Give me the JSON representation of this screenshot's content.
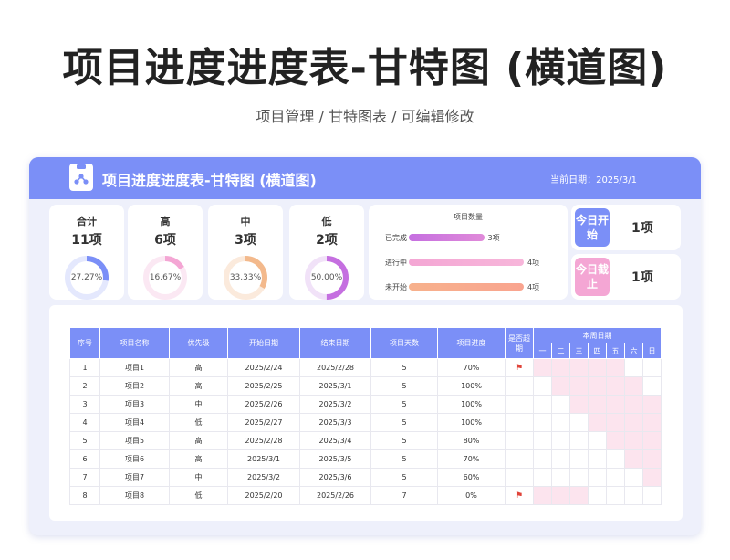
{
  "page": {
    "title": "项目进度进度表-甘特图 (横道图)",
    "subtitle": "项目管理 / 甘特图表 /  可编辑修改"
  },
  "header": {
    "title": "项目进度进度表-甘特图 (横道图)",
    "date_label": "当前日期：",
    "date_value": "2025/3/1"
  },
  "stats": [
    {
      "label": "合计",
      "count": "11项",
      "pct": "27.27%",
      "value": 0.2727,
      "color": "#7b8ff7",
      "track": "#e4e8fd"
    },
    {
      "label": "高",
      "count": "6项",
      "pct": "16.67%",
      "value": 0.1667,
      "color": "#f4a6d4",
      "track": "#fbe8f3"
    },
    {
      "label": "中",
      "count": "3项",
      "pct": "33.33%",
      "value": 0.3333,
      "color": "#f3b98c",
      "track": "#fbeadc"
    },
    {
      "label": "低",
      "count": "2项",
      "pct": "50.00%",
      "value": 0.5,
      "color": "#c56fe0",
      "track": "#f1e2f8"
    }
  ],
  "bar_chart": {
    "title": "项目数量",
    "rows": [
      {
        "label": "已完成",
        "value": 3,
        "value_label": "3项",
        "color_from": "#c56fe0",
        "color_to": "#e08ad9"
      },
      {
        "label": "进行中",
        "value": 4,
        "value_label": "4项",
        "color_from": "#f4a6d4",
        "color_to": "#f7b6da"
      },
      {
        "label": "未开始",
        "value": 4,
        "value_label": "4项",
        "color_from": "#f7b18c",
        "color_to": "#f9a48f"
      }
    ],
    "max": 4
  },
  "today": [
    {
      "badge": "今日开始",
      "value": "1项",
      "color": "#7b8ff7"
    },
    {
      "badge": "今日截止",
      "value": "1项",
      "color": "#f4a6d4"
    }
  ],
  "table": {
    "headers": {
      "no": "序号",
      "name": "项目名称",
      "priority": "优先级",
      "start": "开始日期",
      "end": "结束日期",
      "days": "项目天数",
      "progress": "项目进度",
      "overdue": "是否超期",
      "week": "本周日期"
    },
    "weekdays": [
      "一",
      "二",
      "三",
      "四",
      "五",
      "六",
      "日"
    ],
    "rows": [
      {
        "no": "1",
        "name": "项目1",
        "priority": "高",
        "start": "2025/2/24",
        "end": "2025/2/28",
        "days": "5",
        "progress": "70%",
        "overdue": true,
        "bars": [
          1,
          1,
          1,
          1,
          1,
          0,
          0
        ]
      },
      {
        "no": "2",
        "name": "项目2",
        "priority": "高",
        "start": "2025/2/25",
        "end": "2025/3/1",
        "days": "5",
        "progress": "100%",
        "overdue": false,
        "bars": [
          0,
          1,
          1,
          1,
          1,
          1,
          0
        ]
      },
      {
        "no": "3",
        "name": "项目3",
        "priority": "中",
        "start": "2025/2/26",
        "end": "2025/3/2",
        "days": "5",
        "progress": "100%",
        "overdue": false,
        "bars": [
          0,
          0,
          1,
          1,
          1,
          1,
          1
        ]
      },
      {
        "no": "4",
        "name": "项目4",
        "priority": "低",
        "start": "2025/2/27",
        "end": "2025/3/3",
        "days": "5",
        "progress": "100%",
        "overdue": false,
        "bars": [
          0,
          0,
          0,
          1,
          1,
          1,
          1
        ]
      },
      {
        "no": "5",
        "name": "项目5",
        "priority": "高",
        "start": "2025/2/28",
        "end": "2025/3/4",
        "days": "5",
        "progress": "80%",
        "overdue": false,
        "bars": [
          0,
          0,
          0,
          0,
          1,
          1,
          1
        ]
      },
      {
        "no": "6",
        "name": "项目6",
        "priority": "高",
        "start": "2025/3/1",
        "end": "2025/3/5",
        "days": "5",
        "progress": "70%",
        "overdue": false,
        "bars": [
          0,
          0,
          0,
          0,
          0,
          1,
          1
        ]
      },
      {
        "no": "7",
        "name": "项目7",
        "priority": "中",
        "start": "2025/3/2",
        "end": "2025/3/6",
        "days": "5",
        "progress": "60%",
        "overdue": false,
        "bars": [
          0,
          0,
          0,
          0,
          0,
          0,
          1
        ]
      },
      {
        "no": "8",
        "name": "项目8",
        "priority": "低",
        "start": "2025/2/20",
        "end": "2025/2/26",
        "days": "7",
        "progress": "0%",
        "overdue": true,
        "bars": [
          1,
          1,
          1,
          0,
          0,
          0,
          0
        ]
      }
    ]
  },
  "colors": {
    "accent": "#7b8ff7",
    "gantt_bar": "#fce4ee",
    "overdue_flag": "#e0443a"
  }
}
